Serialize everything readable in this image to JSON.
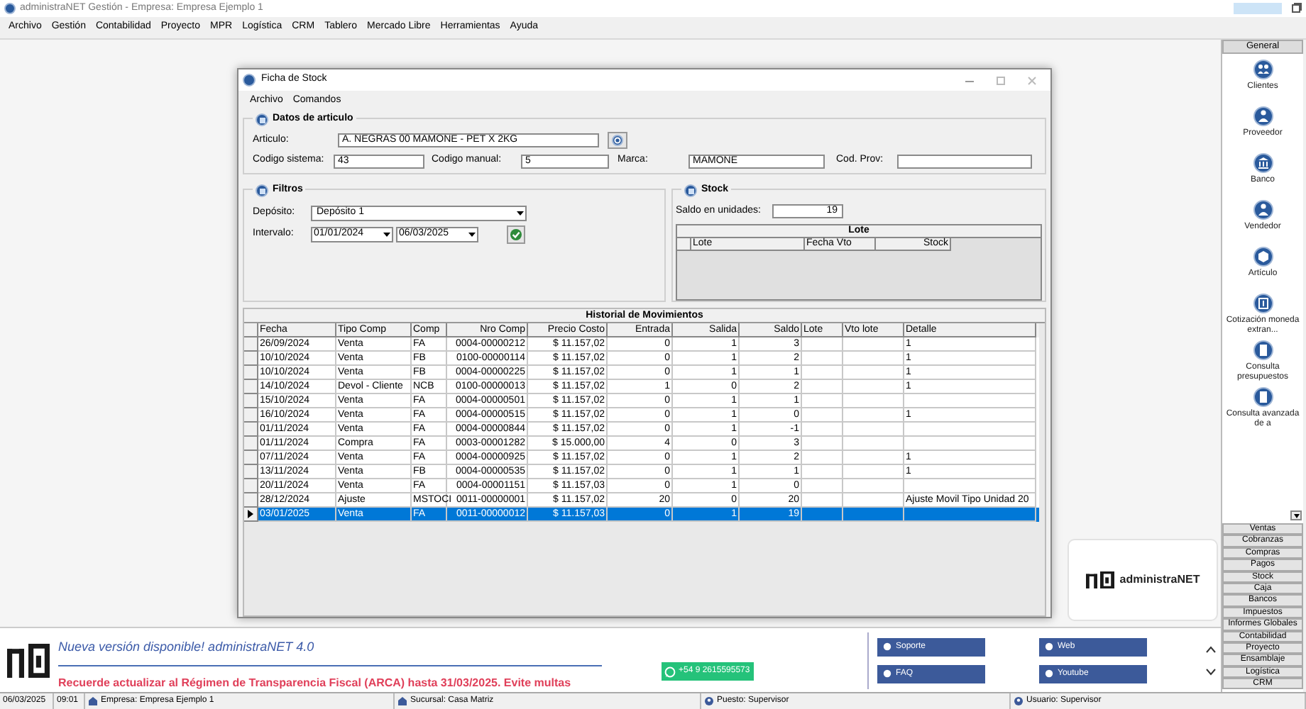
{
  "app": {
    "title": "administraNET Gestión - Empresa: Empresa Ejemplo 1",
    "menu": [
      "Archivo",
      "Gestión",
      "Contabilidad",
      "Proyecto",
      "MPR",
      "Logística",
      "CRM",
      "Tablero",
      "Mercado Libre",
      "Herramientas",
      "Ayuda"
    ]
  },
  "dialog": {
    "title": "Ficha de Stock",
    "menu": [
      "Archivo",
      "Comandos"
    ],
    "article": {
      "title": "Datos de articulo",
      "articulo_label": "Articulo:",
      "articulo_value": "A. NEGRAS 00 MAMONE - PET X 2KG",
      "fields": [
        {
          "label": "Codigo sistema:",
          "value": "43"
        },
        {
          "label": "Codigo manual:",
          "value": "5"
        },
        {
          "label": "Marca:",
          "value": "MAMONE"
        },
        {
          "label": "Cod. Prov:"
        }
      ]
    },
    "filters": {
      "title": "Filtros",
      "deposito_label": "Depósito:",
      "deposito_value": "Depósito 1",
      "intervalo_label": "Intervalo:",
      "from": "01/01/2024",
      "to": "06/03/2025"
    },
    "stock": {
      "title": "Stock",
      "saldo_label": "Saldo en unidades:",
      "saldo_value": "19",
      "lote_title": "Lote",
      "lote_columns": [
        "Lote",
        "Fecha Vto",
        "Stock"
      ]
    },
    "history": {
      "title": "Historial de Movimientos",
      "columns": [
        "Fecha",
        "Tipo Comp",
        "Comp",
        "Nro Comp",
        "Precio Costo",
        "Entrada",
        "Salida",
        "Saldo",
        "Lote",
        "Vto lote",
        "Detalle"
      ],
      "rows": [
        {
          "fecha": "26/09/2024",
          "tipo_comp": "Venta",
          "comp": "FA",
          "nro_comp": "0004-00000212",
          "precio_costo": "$ 11.157,02",
          "entrada": "0",
          "salida": "1",
          "saldo": "3",
          "detalle": "1",
          "selected": false
        },
        {
          "fecha": "10/10/2024",
          "tipo_comp": "Venta",
          "comp": "FB",
          "nro_comp": "0100-00000114",
          "precio_costo": "$ 11.157,02",
          "entrada": "0",
          "salida": "1",
          "saldo": "2",
          "detalle": "1",
          "selected": false
        },
        {
          "fecha": "10/10/2024",
          "tipo_comp": "Venta",
          "comp": "FB",
          "nro_comp": "0004-00000225",
          "precio_costo": "$ 11.157,02",
          "entrada": "0",
          "salida": "1",
          "saldo": "1",
          "detalle": "1",
          "selected": false
        },
        {
          "fecha": "14/10/2024",
          "tipo_comp": "Devol - Cliente",
          "comp": "NCB",
          "nro_comp": "0100-00000013",
          "precio_costo": "$ 11.157,02",
          "entrada": "1",
          "salida": "0",
          "saldo": "2",
          "detalle": "1",
          "selected": false
        },
        {
          "fecha": "15/10/2024",
          "tipo_comp": "Venta",
          "comp": "FA",
          "nro_comp": "0004-00000501",
          "precio_costo": "$ 11.157,02",
          "entrada": "0",
          "salida": "1",
          "saldo": "1",
          "selected": false
        },
        {
          "fecha": "16/10/2024",
          "tipo_comp": "Venta",
          "comp": "FA",
          "nro_comp": "0004-00000515",
          "precio_costo": "$ 11.157,02",
          "entrada": "0",
          "salida": "1",
          "saldo": "0",
          "detalle": "1",
          "selected": false
        },
        {
          "fecha": "01/11/2024",
          "tipo_comp": "Venta",
          "comp": "FA",
          "nro_comp": "0004-00000844",
          "precio_costo": "$ 11.157,02",
          "entrada": "0",
          "salida": "1",
          "saldo": "-1",
          "selected": false
        },
        {
          "fecha": "01/11/2024",
          "tipo_comp": "Compra",
          "comp": "FA",
          "nro_comp": "0003-00001282",
          "precio_costo": "$ 15.000,00",
          "entrada": "4",
          "salida": "0",
          "saldo": "3",
          "selected": false
        },
        {
          "fecha": "07/11/2024",
          "tipo_comp": "Venta",
          "comp": "FA",
          "nro_comp": "0004-00000925",
          "precio_costo": "$ 11.157,02",
          "entrada": "0",
          "salida": "1",
          "saldo": "2",
          "detalle": "1",
          "selected": false
        },
        {
          "fecha": "13/11/2024",
          "tipo_comp": "Venta",
          "comp": "FB",
          "nro_comp": "0004-00000535",
          "precio_costo": "$ 11.157,02",
          "entrada": "0",
          "salida": "1",
          "saldo": "1",
          "detalle": "1",
          "selected": false
        },
        {
          "fecha": "20/11/2024",
          "tipo_comp": "Venta",
          "comp": "FA",
          "nro_comp": "0004-00001151",
          "precio_costo": "$ 11.157,03",
          "entrada": "0",
          "salida": "1",
          "saldo": "0",
          "selected": false
        },
        {
          "fecha": "28/12/2024",
          "tipo_comp": "Ajuste",
          "comp": "MSTOCI",
          "nro_comp": "0011-00000001",
          "precio_costo": "$ 11.157,02",
          "entrada": "20",
          "salida": "0",
          "saldo": "20",
          "detalle": "Ajuste Movil Tipo Unidad  20",
          "selected": false
        },
        {
          "fecha": "03/01/2025",
          "tipo_comp": "Venta",
          "comp": "FA",
          "nro_comp": "0011-00000012",
          "precio_costo": "$ 11.157,03",
          "entrada": "0",
          "salida": "1",
          "saldo": "19",
          "selected": true
        }
      ]
    }
  },
  "brand": {
    "name": "administraNET"
  },
  "sidebar": {
    "header": "General",
    "items": [
      {
        "label": "Clientes",
        "kind": "people"
      },
      {
        "label": "Proveedor",
        "kind": "person"
      },
      {
        "label": "Banco",
        "kind": "bank"
      },
      {
        "label": "Vendedor",
        "kind": "person"
      },
      {
        "label": "Artículo",
        "kind": "box"
      },
      {
        "label": "Cotización moneda extran...",
        "kind": "money"
      },
      {
        "label": "Consulta presupuestos",
        "kind": "document"
      },
      {
        "label": "Consulta avanzada de a",
        "kind": "document"
      }
    ],
    "sections": [
      "Ventas",
      "Cobranzas",
      "Compras",
      "Pagos",
      "Stock",
      "Caja",
      "Bancos",
      "Impuestos",
      "Informes Globales",
      "Contabilidad",
      "Proyecto",
      "Ensamblaje",
      "Logística",
      "CRM"
    ]
  },
  "banner": {
    "headline": "Nueva versión disponible! administraNET 4.0",
    "notice": "Recuerde actualizar al Régimen de Transparencia Fiscal (ARCA) hasta 31/03/2025. Evite multas",
    "whatsapp": "+54 9 2615595573",
    "links": [
      "Soporte",
      "Web",
      "FAQ",
      "Youtube"
    ]
  },
  "status_bar": {
    "date": "06/03/2025",
    "time": "09:01",
    "empresa": "Empresa: Empresa Ejemplo 1",
    "sucursal": "Sucursal: Casa Matriz",
    "puesto": "Puesto: Supervisor",
    "usuario": "Usuario: Supervisor"
  }
}
